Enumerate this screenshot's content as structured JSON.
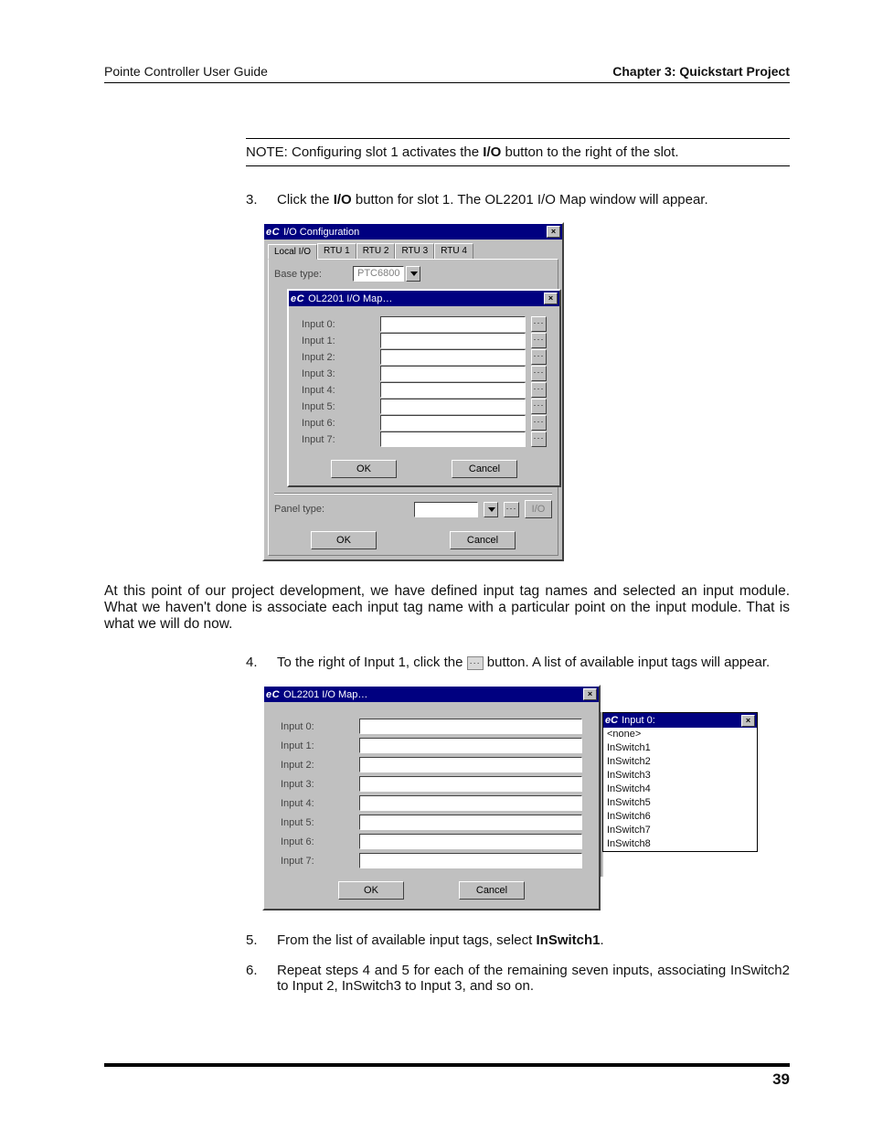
{
  "header": {
    "left": "Pointe Controller User Guide",
    "right": "Chapter 3: Quickstart Project"
  },
  "note": {
    "prefix": "NOTE: Configuring slot 1 activates the ",
    "bold1": "I/O",
    "suffix": " button to the right of the slot."
  },
  "steps": {
    "s3": {
      "num": "3.",
      "p1a": "Click the ",
      "p1b": "I/O",
      "p1c": " button for slot 1. The OL2201 I/O Map window will appear."
    },
    "s4": {
      "num": "4.",
      "p1a": "To the right of Input 1, click the ",
      "p1b": " button. A list of available input tags will appear."
    },
    "s5": {
      "num": "5.",
      "a": "From the list of available input tags, select ",
      "b": "InSwitch1",
      "c": "."
    },
    "s6": {
      "num": "6.",
      "t": "Repeat steps 4 and 5 for each of the remaining seven inputs, associating InSwitch2 to Input 2, InSwitch3 to Input 3, and so on."
    }
  },
  "midtext": "At this point of our project development, we have defined input tag names and selected an input module. What we haven't done is associate each input tag name with a particular point on the input module. That is what we will do now.",
  "fig1": {
    "outer_title_italic": "eC",
    "outer_title_plain": " I/O Configuration",
    "tabs": [
      "Local I/O",
      "RTU 1",
      "RTU 2",
      "RTU 3",
      "RTU 4"
    ],
    "base_label": "Base type:",
    "base_value": "PTC6800",
    "inner_title_italic": "eC",
    "inner_title_plain": " OL2201 I/O Map…",
    "inputs": [
      "Input 0:",
      "Input 1:",
      "Input 2:",
      "Input 3:",
      "Input 4:",
      "Input 5:",
      "Input 6:",
      "Input 7:"
    ],
    "ok": "OK",
    "cancel": "Cancel",
    "panel_label": "Panel type:",
    "io_label": "I/O"
  },
  "fig2": {
    "map_title_italic": "eC",
    "map_title_plain": " OL2201 I/O Map…",
    "inputs": [
      "Input 0:",
      "Input 1:",
      "Input 2:",
      "Input 3:",
      "Input 4:",
      "Input 5:",
      "Input 6:",
      "Input 7:"
    ],
    "ok": "OK",
    "cancel": "Cancel",
    "pop_title_italic": "eC",
    "pop_title_plain": " Input 0:",
    "options": [
      "<none>",
      "InSwitch1",
      "InSwitch2",
      "InSwitch3",
      "InSwitch4",
      "InSwitch5",
      "InSwitch6",
      "InSwitch7",
      "InSwitch8"
    ]
  },
  "page_number": "39"
}
